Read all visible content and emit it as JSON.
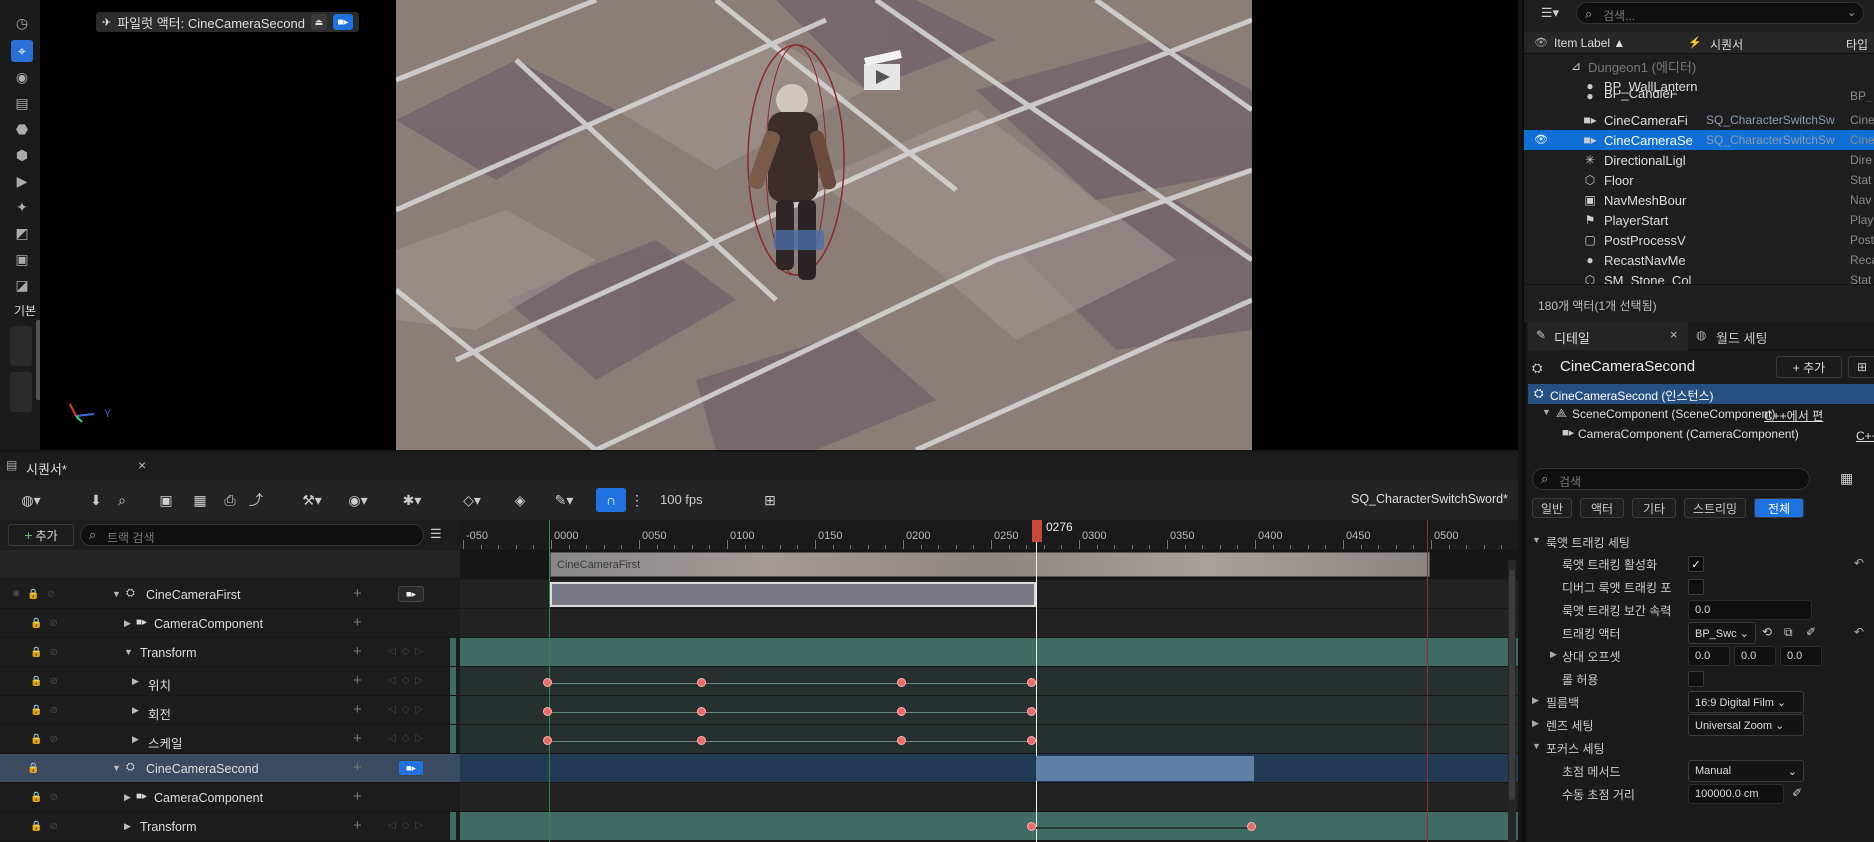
{
  "viewport": {
    "pilot_label": "파일럿 액터: CineCameraSecond",
    "axis_y": "Y",
    "mode_label": "기본"
  },
  "outliner": {
    "search_placeholder": "검색...",
    "col_label": "Item Label ▲",
    "col_sequencer": "시퀀서",
    "col_type": "타입",
    "items": [
      {
        "label": "Dungeon1 (에디터)",
        "seq": "",
        "type": "",
        "icon": "level-icon",
        "dim": true
      },
      {
        "label": "BP_WallLantern",
        "seq": "",
        "type": "",
        "icon": "actor-icon"
      },
      {
        "label": "BP_CandleF",
        "seq": "",
        "type": "BP_",
        "icon": "actor-icon"
      },
      {
        "label": "CineCameraFi",
        "seq": "SQ_CharacterSwitchSw",
        "type": "Cine",
        "icon": "camera-icon"
      },
      {
        "label": "CineCameraSe",
        "seq": "SQ_CharacterSwitchSw",
        "type": "Cine",
        "icon": "camera-icon",
        "selected": true
      },
      {
        "label": "DirectionalLigl",
        "seq": "",
        "type": "Dire",
        "icon": "light-icon"
      },
      {
        "label": "Floor",
        "seq": "",
        "type": "Stat",
        "icon": "mesh-icon"
      },
      {
        "label": "NavMeshBour",
        "seq": "",
        "type": "Nav",
        "icon": "navmesh-icon"
      },
      {
        "label": "PlayerStart",
        "seq": "",
        "type": "Play",
        "icon": "player-start-icon"
      },
      {
        "label": "PostProcessV",
        "seq": "",
        "type": "Post",
        "icon": "postprocess-icon"
      },
      {
        "label": "RecastNavMe",
        "seq": "",
        "type": "Reca",
        "icon": "sphere-icon"
      },
      {
        "label": "SM_Stone_Col",
        "seq": "",
        "type": "Stat",
        "icon": "mesh-icon"
      }
    ],
    "status": "180개 액터(1개 선택됨)"
  },
  "details": {
    "tab_details": "디테일",
    "tab_world": "월드 세팅",
    "object_name": "CineCameraSecond",
    "add_label": "+ 추가",
    "instance_label": "CineCameraSecond (인스턴스)",
    "scene_component": "SceneComponent (SceneComponent)",
    "camera_component": "CameraComponent (CameraComponent)",
    "cpp_link": "C++에서 편",
    "cpp_link2": "C++에서",
    "search_placeholder": "검색",
    "filters": [
      "일반",
      "액터",
      "기타",
      "스트리밍",
      "전체"
    ],
    "active_filter": "전체",
    "section_lookat": "룩앳 트래킹 세팅",
    "lookat_enable": "룩앳 트래킹 활성화",
    "lookat_debug": "디버그 룩앳 트래킹 포",
    "lookat_speed": "룩앳 트래킹 보간 속력",
    "lookat_speed_val": "0.0",
    "track_actor": "트래킹 액터",
    "track_actor_val": "BP_Swc",
    "relative_offset": "상대 오프셋",
    "offset_vals": [
      "0.0",
      "0.0",
      "0.0"
    ],
    "allow_roll": "롤 허용",
    "filmback": "필름백",
    "filmback_val": "16:9 Digital Film",
    "lens": "렌즈 세팅",
    "lens_val": "Universal Zoom",
    "focus": "포커스 세팅",
    "focus_method": "초점 메서드",
    "focus_method_val": "Manual",
    "manual_focus": "수동 초점 거리",
    "manual_focus_val": "100000.0 cm"
  },
  "sequencer": {
    "tab_label": "시퀀서*",
    "add_label": "추가",
    "search_placeholder": "트랙 검색",
    "fps": "100 fps",
    "sequence_name": "SQ_CharacterSwitchSword*",
    "playhead_frame": "0276",
    "ticks": [
      "-050",
      "0000",
      "0050",
      "0100",
      "0150",
      "0200",
      "0250",
      "0300",
      "0350",
      "0400",
      "0450",
      "0500"
    ],
    "camera_cut_label": "CineCameraFirst",
    "tracks": [
      {
        "name": "CineCameraFirst",
        "level": 0,
        "kind": "actor"
      },
      {
        "name": "CameraComponent",
        "level": 1,
        "kind": "component"
      },
      {
        "name": "Transform",
        "level": 1,
        "kind": "transform"
      },
      {
        "name": "위치",
        "level": 2,
        "kind": "channel"
      },
      {
        "name": "회전",
        "level": 2,
        "kind": "channel"
      },
      {
        "name": "스케일",
        "level": 2,
        "kind": "channel"
      },
      {
        "name": "CineCameraSecond",
        "level": 0,
        "kind": "actor",
        "selected": true
      },
      {
        "name": "CameraComponent",
        "level": 1,
        "kind": "component"
      },
      {
        "name": "Transform",
        "level": 1,
        "kind": "transform"
      }
    ]
  },
  "colors": {
    "accent": "#0f6fd6",
    "keyframe": "#e86a6a",
    "transform_lane": "#3f6b63",
    "playhead": "#c44a3a"
  }
}
